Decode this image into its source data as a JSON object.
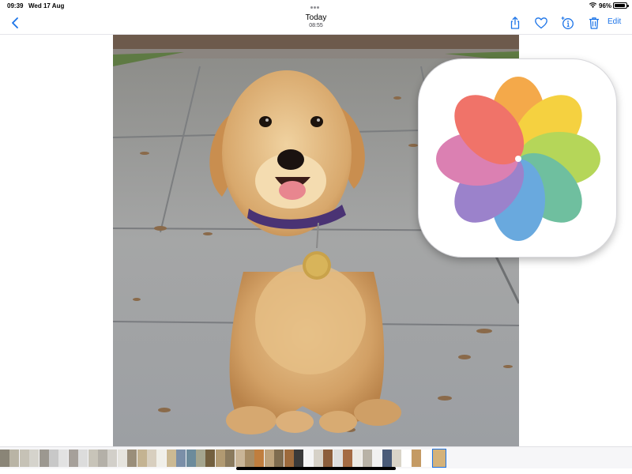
{
  "status_bar": {
    "time": "09:39",
    "date": "Wed 17 Aug",
    "battery_percent": "96%",
    "battery_level": 0.96
  },
  "nav": {
    "title": "Today",
    "subtitle": "08:55",
    "edit_label": "Edit",
    "accent_color": "#1a73e8"
  },
  "icons": {
    "back": "chevron-left-icon",
    "share": "share-icon",
    "favorite": "heart-icon",
    "info": "info-sparkle-icon",
    "delete": "trash-icon",
    "app": "photos-app-icon"
  },
  "photo": {
    "subject": "golden retriever puppy"
  },
  "thumbnails": {
    "colors": [
      "#8a8577",
      "#b9b4a5",
      "#c6c2b6",
      "#d5d3cc",
      "#9c9890",
      "#c8c8c8",
      "#e2e2e2",
      "#a6a09a",
      "#dcdcdc",
      "#c8c4b9",
      "#b4b0a8",
      "#d2cfc9",
      "#e6e4de",
      "#9a8e7a",
      "#c4b392",
      "#d8cfbf",
      "#f0efe9",
      "#cbb993",
      "#7b8fa8",
      "#6c8b9b",
      "#a4a58e",
      "#73603f",
      "#b19a72",
      "#8b7b5e",
      "#c9b597",
      "#a68c65",
      "#c07e3e",
      "#bda27b",
      "#7f6c4f",
      "#9d6a3c",
      "#3a3a3a",
      "#f4f4f4",
      "#d6d1c7",
      "#8c5e3b",
      "#dedede",
      "#a46b43",
      "#eceae4",
      "#b8b2a6",
      "#f1f1f1",
      "#4a5b78",
      "#d9d4c8",
      "#ffffff",
      "#c49a64",
      "#ffffff",
      "#d4b27a"
    ],
    "selected_index": 44
  }
}
